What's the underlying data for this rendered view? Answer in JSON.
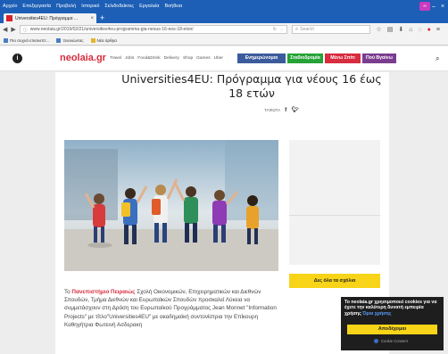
{
  "browser": {
    "menu": [
      "Αρχείο",
      "Επεξεργασία",
      "Προβολή",
      "Ιστορικό",
      "Σελιδοδείκτες",
      "Εργαλεία",
      "Βοήθεια"
    ],
    "tab_title": "Universities4EU: Πρόγραμμα ...",
    "tab_close": "×",
    "new_tab": "+",
    "url": "www.neolaia.gr/2019/02/21/universities4eu-programma-gia-neous-16-eos-18-eton/",
    "search_placeholder": "Search",
    "bookmarks": [
      "Πιο συχνά επισκεπτ...",
      "Ξεκινώντας",
      "Νέα άρθρα"
    ]
  },
  "site": {
    "logo": "neolaia.gr",
    "nav": [
      "Travel",
      "Jobs",
      "Food&Drink",
      "Delivery",
      "Shop",
      "Games",
      "Uber"
    ],
    "buttons": {
      "update": "Ενημερώνομαι",
      "opportunities": "Σταδιοδρομία",
      "stay_home": "Μένω Σπίτι",
      "where_go": "Πού Βγαίνω"
    },
    "menu_icon": "i",
    "search_icon": "⌕"
  },
  "article": {
    "title": "Universities4EU: Πρόγραμμα για νέους 16 έως 18 ετών",
    "share_label": "ΤΛΦΩΤΑ",
    "body_prefix": "Το ",
    "body_bold": "Πανεπιστήμιο Πειραιώς",
    "body_text": " Σχολή Οικονομικών, Επιχειρηματικών και Διεθνών Σπουδών, Τμήμα Διεθνών και Ευρωπαϊκών Σπουδών προσκαλεί Λύκεια να συμμετάσχουν στη Δράση του Ευρωπαϊκού Προγράμματος Jean Monnet \"Information Projects\" με τίτλο\"Universities4EU\" με ακαδημαϊκή συντονίστρια την Επίκουρη Καθηγήτρια Φωτεινή Ασδερακη"
  },
  "sidebar": {
    "button": "Δες όλα τα σχόλια"
  },
  "cookie": {
    "text": "To neolaia.gr χρησιμοποιεί cookies για να έχετε την καλύτερη δυνατή εμπειρία χρήσης",
    "link": "Όροι χρήσης",
    "accept": "Αποδέχομαι",
    "powered": "Cookie Consent"
  }
}
